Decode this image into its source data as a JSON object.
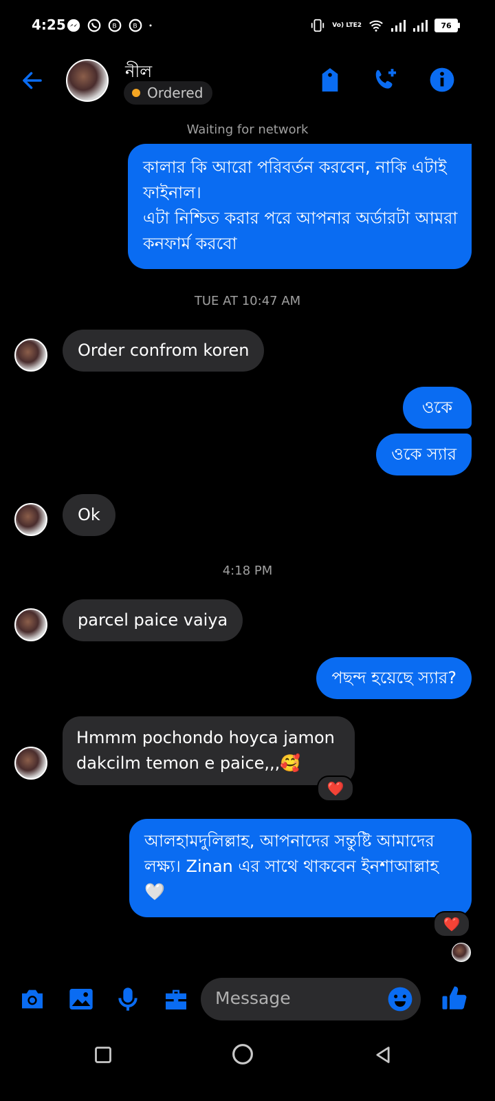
{
  "status_bar": {
    "time": "4:25",
    "battery": "76",
    "network_label": "Vo) LTE2"
  },
  "header": {
    "name": "নীল",
    "badge": "Ordered",
    "back_icon": "arrow-left-icon",
    "tag_icon": "tag-icon",
    "call_icon": "add-call-icon",
    "info_icon": "info-icon"
  },
  "banner": "Waiting for network",
  "messages": [
    {
      "side": "out",
      "text": "কালার কি আরো পরিবর্তন করবেন, নাকি এটাই ফাইনাল।\nএটা নিশ্চিত করার পরে আপনার অর্ডারটা আমরা কনফার্ম করবো"
    },
    {
      "type": "timestamp",
      "text": "TUE AT 10:47 AM"
    },
    {
      "side": "in",
      "text": "Order confrom koren"
    },
    {
      "side": "out",
      "text": "ওকে"
    },
    {
      "side": "out",
      "text": "ওকে স্যার"
    },
    {
      "side": "in",
      "text": "Ok"
    },
    {
      "type": "timestamp",
      "text": "4:18 PM"
    },
    {
      "side": "in",
      "text": "parcel paice vaiya"
    },
    {
      "side": "out",
      "text": "পছন্দ হয়েছে স্যার?"
    },
    {
      "side": "in",
      "text": "Hmmm pochondo hoyca jamon dakcilm temon e paice,,,🥰",
      "reaction": "❤️"
    },
    {
      "side": "out",
      "text": "আলহামদুলিল্লাহ, আপনাদের সন্তুষ্টি আমাদের লক্ষ্য। Zinan এর সাথে থাকবেন ইনশাআল্লাহ 🤍",
      "reaction": "❤️"
    }
  ],
  "composer": {
    "placeholder": "Message",
    "icons": [
      "camera-icon",
      "gallery-icon",
      "microphone-icon",
      "briefcase-icon",
      "emoji-icon",
      "thumbs-up-icon"
    ]
  },
  "colors": {
    "accent": "#0a6cf2",
    "incoming_bubble": "#2b2b2d",
    "badge_dot": "#f5a623"
  }
}
